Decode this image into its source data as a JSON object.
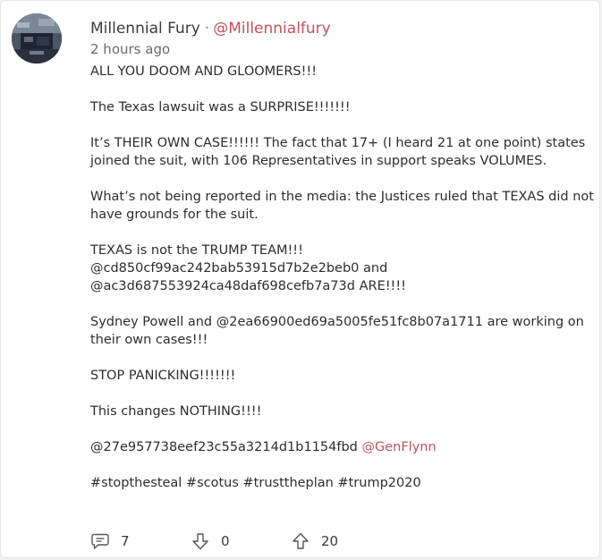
{
  "post": {
    "author_name": "Millennial Fury",
    "separator": "·",
    "author_handle": "@Millennialfury",
    "timestamp": "2 hours ago",
    "paragraphs": [
      "ALL YOU DOOM AND GLOOMERS!!!",
      "The Texas lawsuit was a SURPRISE!!!!!!!",
      "It’s THEIR OWN CASE!!!!!! The fact that 17+ (I heard 21 at one point) states joined the suit, with 106 Representatives in support speaks VOLUMES.",
      "What’s not being reported in the media: the Justices ruled that TEXAS did not have grounds for the suit.",
      "TEXAS is not the TRUMP TEAM!!!\n@cd850cf99ac242bab53915d7b2e2beb0 and\n@ac3d687553924ca48daf698cefb7a73d ARE!!!!",
      "Sydney Powell and @2ea66900ed69a5005fe51fc8b07a1711 are working on their own cases!!!",
      "STOP PANICKING!!!!!!!",
      "This changes NOTHING!!!!"
    ],
    "mention_line_prefix": "@27e957738eef23c55a3214d1b1154fbd ",
    "mention_line_link": "@GenFlynn",
    "hashtags": "#stopthesteal #scotus #trusttheplan #trump2020"
  },
  "actions": {
    "comments": "7",
    "downvotes": "0",
    "upvotes": "20"
  },
  "colors": {
    "accent": "#c0535d",
    "text": "#2d2d2d",
    "muted": "#6a6a6a"
  },
  "icons": {
    "avatar": "avatar-image",
    "comment": "comment-icon",
    "downvote": "arrow-down-icon",
    "upvote": "arrow-up-icon"
  }
}
